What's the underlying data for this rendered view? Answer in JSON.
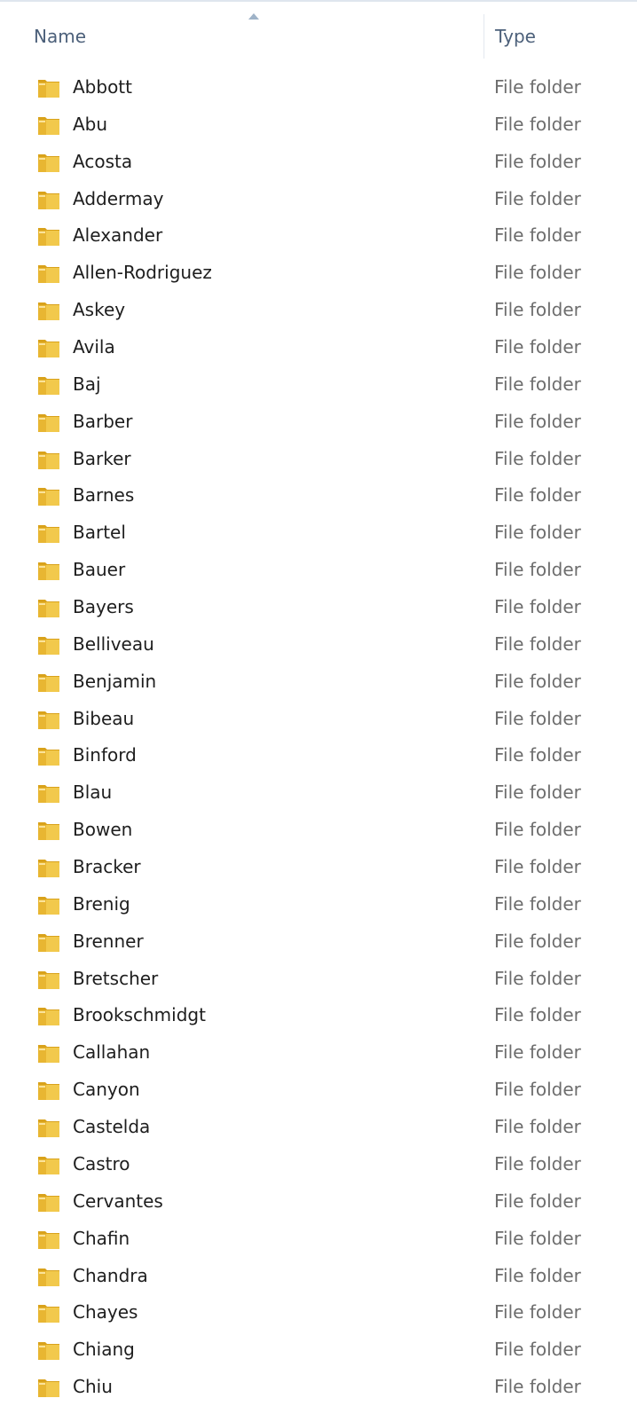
{
  "columns": {
    "name": "Name",
    "type": "Type"
  },
  "rows": [
    {
      "name": "Abbott",
      "type": "File folder"
    },
    {
      "name": "Abu",
      "type": "File folder"
    },
    {
      "name": "Acosta",
      "type": "File folder"
    },
    {
      "name": "Addermay",
      "type": "File folder"
    },
    {
      "name": "Alexander",
      "type": "File folder"
    },
    {
      "name": "Allen-Rodriguez",
      "type": "File folder"
    },
    {
      "name": "Askey",
      "type": "File folder"
    },
    {
      "name": "Avila",
      "type": "File folder"
    },
    {
      "name": "Baj",
      "type": "File folder"
    },
    {
      "name": "Barber",
      "type": "File folder"
    },
    {
      "name": "Barker",
      "type": "File folder"
    },
    {
      "name": "Barnes",
      "type": "File folder"
    },
    {
      "name": "Bartel",
      "type": "File folder"
    },
    {
      "name": "Bauer",
      "type": "File folder"
    },
    {
      "name": "Bayers",
      "type": "File folder"
    },
    {
      "name": "Belliveau",
      "type": "File folder"
    },
    {
      "name": "Benjamin",
      "type": "File folder"
    },
    {
      "name": "Bibeau",
      "type": "File folder"
    },
    {
      "name": "Binford",
      "type": "File folder"
    },
    {
      "name": "Blau",
      "type": "File folder"
    },
    {
      "name": "Bowen",
      "type": "File folder"
    },
    {
      "name": "Bracker",
      "type": "File folder"
    },
    {
      "name": "Brenig",
      "type": "File folder"
    },
    {
      "name": "Brenner",
      "type": "File folder"
    },
    {
      "name": "Bretscher",
      "type": "File folder"
    },
    {
      "name": "Brookschmidgt",
      "type": "File folder"
    },
    {
      "name": "Callahan",
      "type": "File folder"
    },
    {
      "name": "Canyon",
      "type": "File folder"
    },
    {
      "name": "Castelda",
      "type": "File folder"
    },
    {
      "name": "Castro",
      "type": "File folder"
    },
    {
      "name": "Cervantes",
      "type": "File folder"
    },
    {
      "name": "Chafin",
      "type": "File folder"
    },
    {
      "name": "Chandra",
      "type": "File folder"
    },
    {
      "name": "Chayes",
      "type": "File folder"
    },
    {
      "name": "Chiang",
      "type": "File folder"
    },
    {
      "name": "Chiu",
      "type": "File folder"
    }
  ],
  "icons": {
    "row_icon": "folder-icon",
    "sort_indicator": "sort-ascending-icon"
  },
  "colors": {
    "header_text": "#4c607a",
    "name_text": "#1e1e1e",
    "type_text": "#6d6d6d",
    "folder_body": "#f2c94c",
    "folder_dark": "#d9a21b"
  }
}
